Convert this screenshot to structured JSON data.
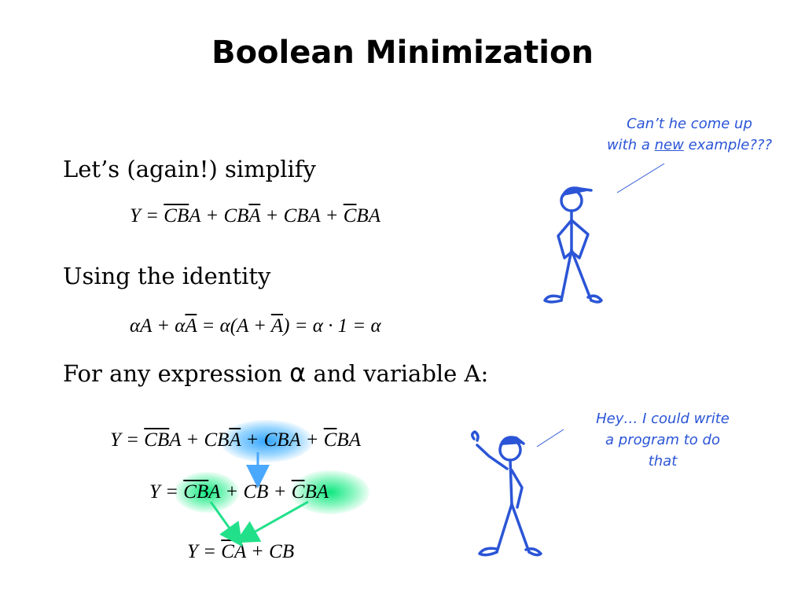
{
  "title": "Boolean Minimization",
  "lines": {
    "simplify": "Let’s (again!) simplify",
    "identity": "Using the identity",
    "expression_prefix": "For any expression",
    "alpha_symbol": "α",
    "expression_suffix": "and variable A:"
  },
  "equations": {
    "eq1": [
      "Y = ",
      "C",
      "B",
      "A + CB",
      "A",
      " + CBA + ",
      "C",
      "BA"
    ],
    "identity": [
      "αA + α",
      "A",
      " = α(A + ",
      "A",
      ") = α · 1 = α"
    ],
    "eq2": [
      "Y = ",
      "C",
      "B",
      "A + CB",
      "A",
      " + CBA + ",
      "C",
      "BA"
    ],
    "eq3": [
      "Y = ",
      "C",
      "B",
      "A + CB + ",
      "C",
      "BA"
    ],
    "eq4": [
      "Y = ",
      "C",
      "A + CB"
    ]
  },
  "speech": {
    "top_line1": "Can’t he come up",
    "top_line2_a": "with a ",
    "top_line2_u": "new",
    "top_line2_b": " example???",
    "bottom_line1": "Hey… I could write",
    "bottom_line2": "a program to do",
    "bottom_line3": "that"
  },
  "colors": {
    "figure": "#2b55d6",
    "speech_text": "#2b55d6",
    "arrow_blue": "#4aa8ff",
    "arrow_green": "#22e08a"
  }
}
